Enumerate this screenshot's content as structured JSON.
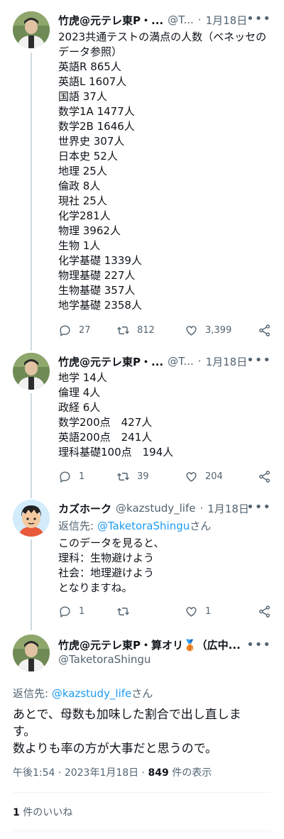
{
  "tweet1": {
    "name": "竹虎@元テレ東P・...",
    "handle": "@T...",
    "date": "1月18日",
    "lines": [
      "2023共通テストの満点の人数（ベネッセの",
      "データ参照）",
      "英語R 865人",
      "英語L 1607人",
      "国語 37人",
      "数学1A 1477人",
      "数学2B 1646人",
      "世界史 307人",
      "日本史 52人",
      "地理 25人",
      "倫政 8人",
      "現社 25人",
      "化学281人",
      "物理 3962人",
      "生物 1人",
      "化学基礎 1339人",
      "物理基礎 227人",
      "生物基礎 357人",
      "地学基礎 2358人"
    ],
    "replies": "27",
    "retweets": "812",
    "likes": "3,399"
  },
  "tweet2": {
    "name": "竹虎@元テレ東P・...",
    "handle": "@T...",
    "date": "1月18日",
    "lines": [
      "地学 14人",
      "倫理 4人",
      "政経 6人",
      "数学200点　427人",
      "英語200点　241人",
      "理科基礎100点　194人"
    ],
    "replies": "1",
    "retweets": "39",
    "likes": "204"
  },
  "tweet3": {
    "name": "カズホーク",
    "handle": "@kazstudy_life",
    "date": "1月18日",
    "reply_prefix": "返信先: ",
    "reply_mention": "@TaketoraShingu",
    "reply_suffix": "さん",
    "lines": [
      "このデータを見ると、",
      "理科：生物避けよう",
      "社会：地理避けよう",
      "となりますね。"
    ],
    "replies": "1",
    "retweets": "",
    "likes": "1"
  },
  "main_tweet": {
    "name": "竹虎@元テレ東P・算オリ🥉（広中...",
    "handle": "@TaketoraShingu",
    "reply_prefix": "返信先: ",
    "reply_mention": "@kazstudy_life",
    "reply_suffix": "さん",
    "text_lines": [
      "あとで、母数も加味した割合で出し直しま",
      "す。",
      "数よりも率の方が大事だと思うので。"
    ],
    "time": "午後1:54",
    "date": "2023年1月18日",
    "views_count": "849",
    "views_label": " 件の表示",
    "likes_count": "1",
    "likes_label": " 件のいいね"
  },
  "colors": {
    "accent": "#1d9bf0",
    "secondary": "#536471",
    "divider": "#eff3f4"
  }
}
